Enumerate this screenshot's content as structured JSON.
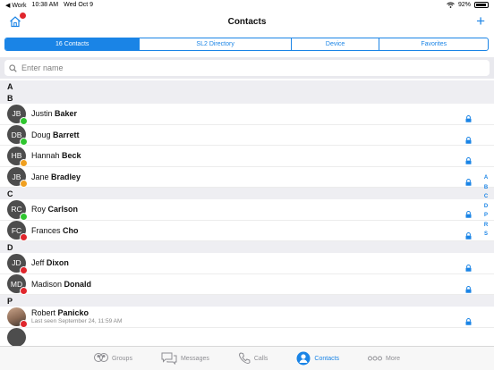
{
  "status": {
    "carrier": "◀ Work",
    "time": "10:38 AM",
    "date": "Wed Oct 9",
    "battery": "92%",
    "battery_level": 0.92
  },
  "nav": {
    "title": "Contacts"
  },
  "segments": [
    {
      "label": "16 Contacts",
      "active": true
    },
    {
      "label": "SL2 Directory",
      "active": false
    },
    {
      "label": "Device",
      "active": false
    },
    {
      "label": "Favorites",
      "active": false
    }
  ],
  "search": {
    "placeholder": "Enter name"
  },
  "sections": [
    {
      "letter": "A",
      "contacts": []
    },
    {
      "letter": "B",
      "contacts": [
        {
          "initials": "JB",
          "first": "Justin",
          "last": "Baker",
          "presence": "#2fc62f",
          "locked": true
        },
        {
          "initials": "DB",
          "first": "Doug",
          "last": "Barrett",
          "presence": "#2fc62f",
          "locked": true
        },
        {
          "initials": "HB",
          "first": "Hannah",
          "last": "Beck",
          "presence": "#f0a020",
          "locked": true
        },
        {
          "initials": "JB",
          "first": "Jane",
          "last": "Bradley",
          "presence": "#f0a020",
          "locked": true
        }
      ]
    },
    {
      "letter": "C",
      "contacts": [
        {
          "initials": "RC",
          "first": "Roy",
          "last": "Carlson",
          "presence": "#2fc62f",
          "locked": true
        },
        {
          "initials": "FC",
          "first": "Frances",
          "last": "Cho",
          "presence": "#e0262c",
          "locked": true
        }
      ]
    },
    {
      "letter": "D",
      "contacts": [
        {
          "initials": "JD",
          "first": "Jeff",
          "last": "Dixon",
          "presence": "#e0262c",
          "locked": true
        },
        {
          "initials": "MD",
          "first": "Madison",
          "last": "Donald",
          "presence": "#e0262c",
          "locked": true
        }
      ]
    },
    {
      "letter": "P",
      "contacts": [
        {
          "initials": "",
          "photo": true,
          "first": "Robert",
          "last": "Panicko",
          "sub": "Last seen September 24, 11:59 AM",
          "presence": "#e0262c",
          "locked": true
        },
        {
          "initials": "",
          "first": "",
          "last": "",
          "presence": "",
          "locked": false
        }
      ]
    }
  ],
  "index": [
    "A",
    "B",
    "C",
    "D",
    "P",
    "R",
    "S"
  ],
  "tabs": [
    {
      "label": "Groups",
      "icon": "groups-icon",
      "active": false
    },
    {
      "label": "Messages",
      "icon": "messages-icon",
      "active": false
    },
    {
      "label": "Calls",
      "icon": "calls-icon",
      "active": false
    },
    {
      "label": "Contacts",
      "icon": "contacts-icon",
      "active": true
    },
    {
      "label": "More",
      "icon": "more-icon",
      "active": false
    }
  ],
  "colors": {
    "accent": "#1a84e6"
  }
}
